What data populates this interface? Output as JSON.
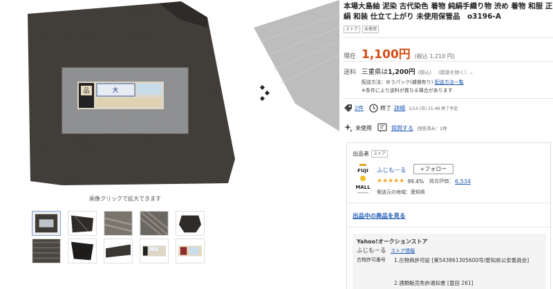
{
  "gallery": {
    "zoom_hint": "画像クリックで拡大できます",
    "label_texts": [
      "品",
      "大"
    ],
    "thumbnails": [
      {
        "icon": "kimono-fabric-tag",
        "active": true
      },
      {
        "icon": "kimono-fold",
        "active": false
      },
      {
        "icon": "kimono-weave",
        "active": false
      },
      {
        "icon": "kimono-texture",
        "active": false
      },
      {
        "icon": "kimono-shape",
        "active": false
      },
      {
        "icon": "kimono-pattern",
        "active": false
      },
      {
        "icon": "kimono-dark",
        "active": false
      },
      {
        "icon": "kimono-strip",
        "active": false
      },
      {
        "icon": "kimono-label",
        "active": false
      },
      {
        "icon": "kimono-label-2",
        "active": false
      }
    ]
  },
  "product": {
    "title": "本場大島紬 泥染 古代染色 着物 純絹手織り物 渋め 着物 和服 正絹 和装 仕立て上がり 未使用保管品　o3196-A",
    "badges": [
      "ストア",
      "未使用"
    ],
    "price": {
      "label": "現在",
      "value": "1,100円",
      "tax": "(税込 1,210 円)"
    },
    "shipping": {
      "label": "送料",
      "text_prefix": "三重県は",
      "amount": "1,200円",
      "tax_note": "(税込)",
      "link_note": "(超過を除く)",
      "method": "配送方法：ゆうパック(補償有り)",
      "method_link": "配送方法一覧",
      "note": "※条件により送料が異なる場合があります"
    },
    "meta": {
      "watch_count": "2件",
      "status": "終了",
      "detail_link": "詳細",
      "end_time": "1/14 (日) 21:48 終了予定"
    },
    "meta2": {
      "condition": "未使用",
      "question_link": "質問する",
      "answered": "回答済み：2件"
    }
  },
  "seller": {
    "head_label": "出品者",
    "store_badge": "ストア",
    "logo_lines": [
      "FUJI",
      "MALL"
    ],
    "name": "ふじも－る",
    "follow_label": "+フォロー",
    "stars": "★★★★★",
    "rating_pct": "99.4%",
    "rating_label": "総合評価：",
    "rating_count": "6,534",
    "origin": "発送元の地域：愛知県",
    "items_link": "出品中の商品を見る",
    "store_box": {
      "title": "Yahoo!オークションストア",
      "name": "ふじも－る",
      "info_link": "ストア情報",
      "license_label": "古物許可番号",
      "license_1": "1.古物商許可証 [第543861305600号/愛知県公安委員会]",
      "license_2": "2.酒類販売免許通知書 [豊田 261]"
    }
  },
  "colors": {
    "price": "#d24d15",
    "link": "#1a56b4",
    "star": "#f5a623"
  }
}
